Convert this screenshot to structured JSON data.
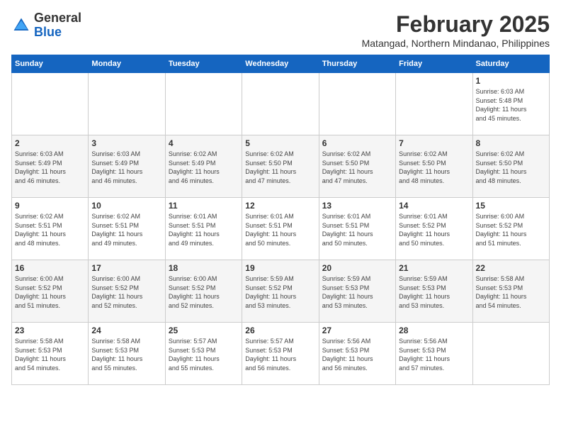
{
  "header": {
    "logo_general": "General",
    "logo_blue": "Blue",
    "month": "February 2025",
    "location": "Matangad, Northern Mindanao, Philippines"
  },
  "days_of_week": [
    "Sunday",
    "Monday",
    "Tuesday",
    "Wednesday",
    "Thursday",
    "Friday",
    "Saturday"
  ],
  "weeks": [
    [
      {
        "day": "",
        "info": ""
      },
      {
        "day": "",
        "info": ""
      },
      {
        "day": "",
        "info": ""
      },
      {
        "day": "",
        "info": ""
      },
      {
        "day": "",
        "info": ""
      },
      {
        "day": "",
        "info": ""
      },
      {
        "day": "1",
        "info": "Sunrise: 6:03 AM\nSunset: 5:48 PM\nDaylight: 11 hours\nand 45 minutes."
      }
    ],
    [
      {
        "day": "2",
        "info": "Sunrise: 6:03 AM\nSunset: 5:49 PM\nDaylight: 11 hours\nand 46 minutes."
      },
      {
        "day": "3",
        "info": "Sunrise: 6:03 AM\nSunset: 5:49 PM\nDaylight: 11 hours\nand 46 minutes."
      },
      {
        "day": "4",
        "info": "Sunrise: 6:02 AM\nSunset: 5:49 PM\nDaylight: 11 hours\nand 46 minutes."
      },
      {
        "day": "5",
        "info": "Sunrise: 6:02 AM\nSunset: 5:50 PM\nDaylight: 11 hours\nand 47 minutes."
      },
      {
        "day": "6",
        "info": "Sunrise: 6:02 AM\nSunset: 5:50 PM\nDaylight: 11 hours\nand 47 minutes."
      },
      {
        "day": "7",
        "info": "Sunrise: 6:02 AM\nSunset: 5:50 PM\nDaylight: 11 hours\nand 48 minutes."
      },
      {
        "day": "8",
        "info": "Sunrise: 6:02 AM\nSunset: 5:50 PM\nDaylight: 11 hours\nand 48 minutes."
      }
    ],
    [
      {
        "day": "9",
        "info": "Sunrise: 6:02 AM\nSunset: 5:51 PM\nDaylight: 11 hours\nand 48 minutes."
      },
      {
        "day": "10",
        "info": "Sunrise: 6:02 AM\nSunset: 5:51 PM\nDaylight: 11 hours\nand 49 minutes."
      },
      {
        "day": "11",
        "info": "Sunrise: 6:01 AM\nSunset: 5:51 PM\nDaylight: 11 hours\nand 49 minutes."
      },
      {
        "day": "12",
        "info": "Sunrise: 6:01 AM\nSunset: 5:51 PM\nDaylight: 11 hours\nand 50 minutes."
      },
      {
        "day": "13",
        "info": "Sunrise: 6:01 AM\nSunset: 5:51 PM\nDaylight: 11 hours\nand 50 minutes."
      },
      {
        "day": "14",
        "info": "Sunrise: 6:01 AM\nSunset: 5:52 PM\nDaylight: 11 hours\nand 50 minutes."
      },
      {
        "day": "15",
        "info": "Sunrise: 6:00 AM\nSunset: 5:52 PM\nDaylight: 11 hours\nand 51 minutes."
      }
    ],
    [
      {
        "day": "16",
        "info": "Sunrise: 6:00 AM\nSunset: 5:52 PM\nDaylight: 11 hours\nand 51 minutes."
      },
      {
        "day": "17",
        "info": "Sunrise: 6:00 AM\nSunset: 5:52 PM\nDaylight: 11 hours\nand 52 minutes."
      },
      {
        "day": "18",
        "info": "Sunrise: 6:00 AM\nSunset: 5:52 PM\nDaylight: 11 hours\nand 52 minutes."
      },
      {
        "day": "19",
        "info": "Sunrise: 5:59 AM\nSunset: 5:52 PM\nDaylight: 11 hours\nand 53 minutes."
      },
      {
        "day": "20",
        "info": "Sunrise: 5:59 AM\nSunset: 5:53 PM\nDaylight: 11 hours\nand 53 minutes."
      },
      {
        "day": "21",
        "info": "Sunrise: 5:59 AM\nSunset: 5:53 PM\nDaylight: 11 hours\nand 53 minutes."
      },
      {
        "day": "22",
        "info": "Sunrise: 5:58 AM\nSunset: 5:53 PM\nDaylight: 11 hours\nand 54 minutes."
      }
    ],
    [
      {
        "day": "23",
        "info": "Sunrise: 5:58 AM\nSunset: 5:53 PM\nDaylight: 11 hours\nand 54 minutes."
      },
      {
        "day": "24",
        "info": "Sunrise: 5:58 AM\nSunset: 5:53 PM\nDaylight: 11 hours\nand 55 minutes."
      },
      {
        "day": "25",
        "info": "Sunrise: 5:57 AM\nSunset: 5:53 PM\nDaylight: 11 hours\nand 55 minutes."
      },
      {
        "day": "26",
        "info": "Sunrise: 5:57 AM\nSunset: 5:53 PM\nDaylight: 11 hours\nand 56 minutes."
      },
      {
        "day": "27",
        "info": "Sunrise: 5:56 AM\nSunset: 5:53 PM\nDaylight: 11 hours\nand 56 minutes."
      },
      {
        "day": "28",
        "info": "Sunrise: 5:56 AM\nSunset: 5:53 PM\nDaylight: 11 hours\nand 57 minutes."
      },
      {
        "day": "",
        "info": ""
      }
    ]
  ]
}
